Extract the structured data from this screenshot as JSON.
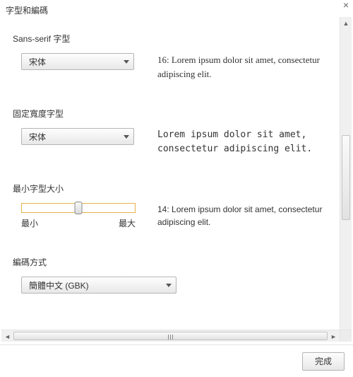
{
  "dialog": {
    "title": "字型和編碼"
  },
  "sections": {
    "sans_serif": {
      "label": "Sans-serif 字型",
      "select_value": "宋体",
      "sample": "16: Lorem ipsum dolor sit amet, consectetur adipiscing elit."
    },
    "fixed_width": {
      "label": "固定寬度字型",
      "select_value": "宋体",
      "sample": "Lorem ipsum dolor sit amet, consectetur adipiscing elit."
    },
    "min_size": {
      "label": "最小字型大小",
      "min_label": "最小",
      "max_label": "最大",
      "sample": "14: Lorem ipsum dolor sit amet, consectetur adipiscing elit."
    },
    "encoding": {
      "label": "編碼方式",
      "select_value": "簡體中文 (GBK)"
    }
  },
  "footer": {
    "done": "完成"
  }
}
